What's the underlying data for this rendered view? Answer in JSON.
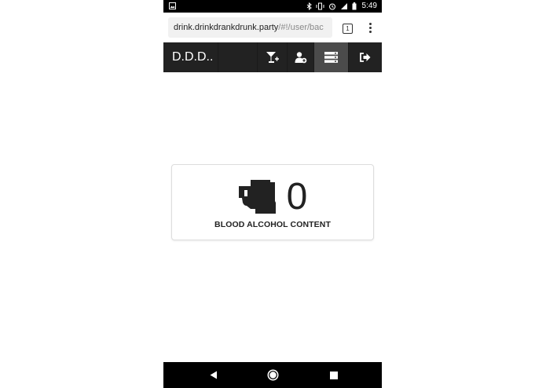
{
  "status_bar": {
    "time": "5:49"
  },
  "browser": {
    "url_domain": "drink.drinkdrankdrunk.party",
    "url_path": "/#!/user/bac",
    "tab_count": "1"
  },
  "navbar": {
    "brand": "D.D.D..",
    "items": [
      {
        "icon": "cocktail-add-icon"
      },
      {
        "icon": "user-add-icon"
      },
      {
        "icon": "server-list-icon",
        "active": true
      },
      {
        "icon": "sign-out-icon"
      }
    ]
  },
  "bac_card": {
    "value": "0",
    "label": "BLOOD ALCOHOL CONTENT"
  },
  "colors": {
    "navbar_bg": "#222222",
    "navbar_active": "#4b4b4b",
    "status_bar_bg": "#000000"
  }
}
